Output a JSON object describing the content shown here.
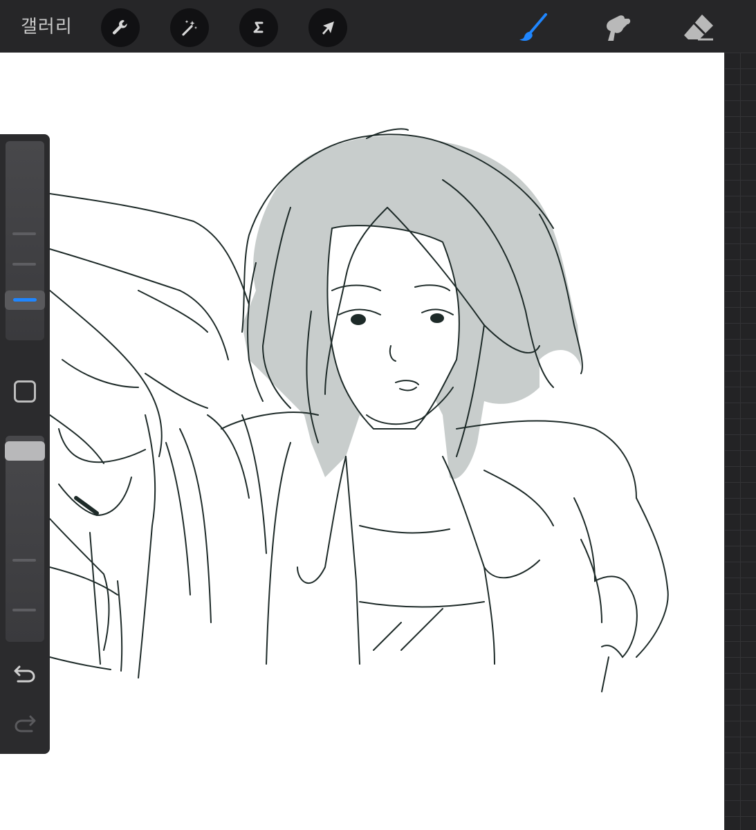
{
  "toolbar": {
    "gallery_label": "갤러리",
    "left_tools": [
      {
        "name": "actions",
        "icon": "wrench-icon"
      },
      {
        "name": "adjustments",
        "icon": "magic-wand-icon"
      },
      {
        "name": "selection",
        "icon": "selection-s-icon"
      },
      {
        "name": "transform",
        "icon": "arrow-cursor-icon"
      }
    ],
    "right_tools": [
      {
        "name": "brush",
        "icon": "brush-icon",
        "active": true
      },
      {
        "name": "smudge",
        "icon": "smudge-finger-icon",
        "active": false
      },
      {
        "name": "eraser",
        "icon": "eraser-icon",
        "active": false
      }
    ]
  },
  "sidebar": {
    "brush_size_level": 0.22,
    "opacity_level": 0.15,
    "undo_icon": "undo-icon",
    "redo_icon": "redo-icon"
  },
  "colors": {
    "accent": "#1f86ff",
    "toolbar_bg": "#262628",
    "canvas_bg": "#ffffff",
    "hair_fill": "#c8cdcc",
    "line": "#1d2a28"
  }
}
